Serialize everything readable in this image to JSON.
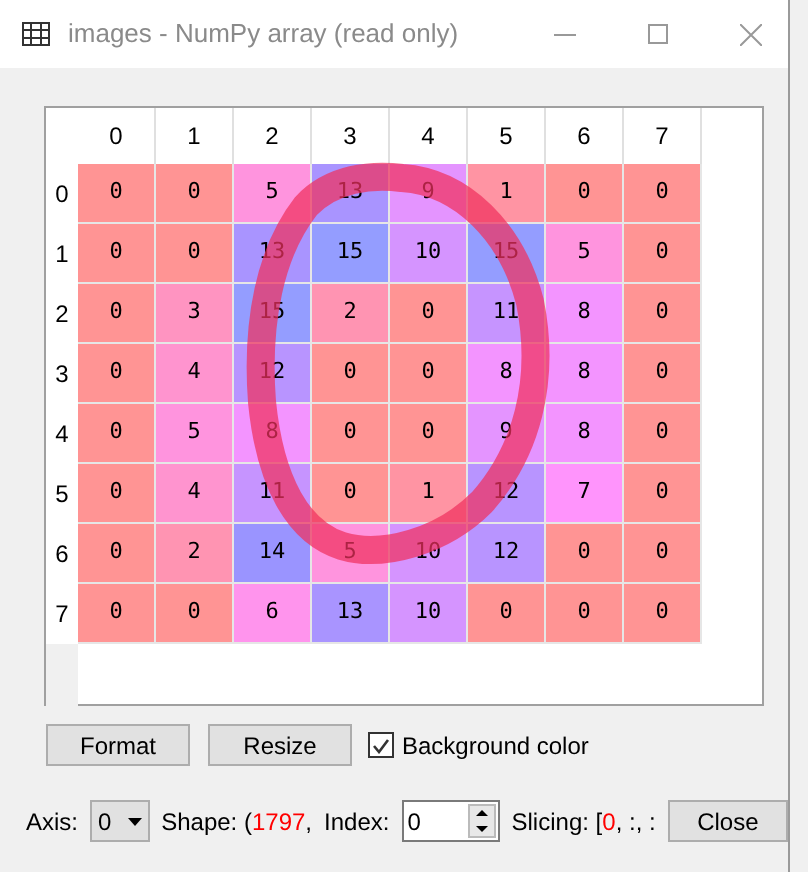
{
  "window": {
    "title": "images - NumPy array (read only)"
  },
  "table": {
    "columns": [
      "0",
      "1",
      "2",
      "3",
      "4",
      "5",
      "6",
      "7"
    ],
    "rows": [
      {
        "header": "0",
        "cells": [
          "0",
          "0",
          "5",
          "13",
          "9",
          "1",
          "0",
          "0"
        ]
      },
      {
        "header": "1",
        "cells": [
          "0",
          "0",
          "13",
          "15",
          "10",
          "15",
          "5",
          "0"
        ]
      },
      {
        "header": "2",
        "cells": [
          "0",
          "3",
          "15",
          "2",
          "0",
          "11",
          "8",
          "0"
        ]
      },
      {
        "header": "3",
        "cells": [
          "0",
          "4",
          "12",
          "0",
          "0",
          "8",
          "8",
          "0"
        ]
      },
      {
        "header": "4",
        "cells": [
          "0",
          "5",
          "8",
          "0",
          "0",
          "9",
          "8",
          "0"
        ]
      },
      {
        "header": "5",
        "cells": [
          "0",
          "4",
          "11",
          "0",
          "1",
          "12",
          "7",
          "0"
        ]
      },
      {
        "header": "6",
        "cells": [
          "0",
          "2",
          "14",
          "5",
          "10",
          "12",
          "0",
          "0"
        ]
      },
      {
        "header": "7",
        "cells": [
          "0",
          "0",
          "6",
          "13",
          "10",
          "0",
          "0",
          "0"
        ]
      }
    ]
  },
  "buttons": [
    "Format",
    "Resize"
  ],
  "background_color": {
    "label": "Background color",
    "checked": true
  },
  "bottom_bar": {
    "axis_label": "Axis:",
    "axis_value": "0",
    "shape": {
      "prefix": "Shape: (",
      "value": "1797",
      "suffix": ","
    },
    "index_label": "Index:",
    "index_value": "0",
    "slicing": {
      "prefix": "Slicing: [",
      "value": "0",
      "suffix": ", :, :"
    },
    "close": "Close"
  }
}
